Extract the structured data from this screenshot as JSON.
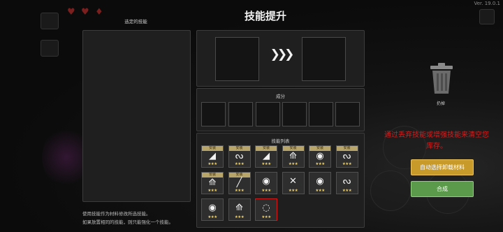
{
  "version": "Ver. 19.0.1",
  "title": "技能提升",
  "selected_skill_label": "选定的技能",
  "materials_label": "成分",
  "skill_list_label": "技能列表",
  "trash_label": "扔掉",
  "warning_line1": "通过丢弃技能或增强技能来清空您",
  "warning_line2": "库存。",
  "auto_select_button": "自动选择卸载材料",
  "merge_button": "合成",
  "hint_line1": "使用技能作为材料修改所选技能。",
  "hint_line2": "如果放置相同的技能，则只能强化一个技能。",
  "arrow_glyph": "❯❯❯",
  "skills": [
    {
      "tag": "安装",
      "glyph": "◢",
      "stars": "★★★",
      "name": "slash"
    },
    {
      "tag": "安装",
      "glyph": "ᔓ",
      "stars": "★★★",
      "name": "serpent"
    },
    {
      "tag": "安装",
      "glyph": "◢",
      "stars": "★★★",
      "name": "slash"
    },
    {
      "tag": "安装",
      "glyph": "⟰",
      "stars": "★★★",
      "name": "arrows"
    },
    {
      "tag": "安装",
      "glyph": "◉",
      "stars": "★★★",
      "name": "orb"
    },
    {
      "tag": "安装",
      "glyph": "ᔓ",
      "stars": "★★★",
      "name": "serpent"
    },
    {
      "tag": "安装",
      "glyph": "⟰",
      "stars": "★★★",
      "name": "arrows"
    },
    {
      "tag": "安装",
      "glyph": "╱",
      "stars": "★★★",
      "name": "beam"
    },
    {
      "tag": "",
      "glyph": "◉",
      "stars": "★★★",
      "name": "orb"
    },
    {
      "tag": "",
      "glyph": "✕",
      "stars": "★★★",
      "name": "cross"
    },
    {
      "tag": "",
      "glyph": "◉",
      "stars": "★★★",
      "name": "orb"
    },
    {
      "tag": "",
      "glyph": "ᔓ",
      "stars": "★★★",
      "name": "serpent"
    },
    {
      "tag": "",
      "glyph": "◉",
      "stars": "★★★",
      "name": "orb"
    },
    {
      "tag": "",
      "glyph": "⟰",
      "stars": "★★★",
      "name": "arrows"
    },
    {
      "tag": "",
      "glyph": "◌",
      "stars": "★★★",
      "name": "swirl"
    }
  ],
  "selected_skill_index": 14,
  "colors": {
    "warning": "#d81c1c",
    "auto_button": "#c79a2a",
    "merge_button": "#5a9a4a",
    "selected_border": "#d21a1a",
    "tag_bg": "#b8a56a"
  }
}
